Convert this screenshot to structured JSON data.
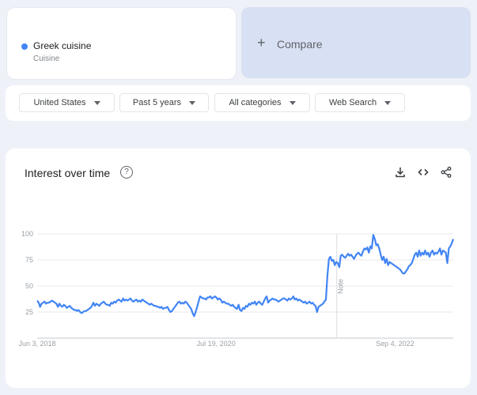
{
  "term": {
    "name": "Greek cuisine",
    "category": "Cuisine",
    "color": "#4285f4"
  },
  "compare": {
    "plus": "+",
    "label": "Compare"
  },
  "filters": [
    {
      "label": "United States"
    },
    {
      "label": "Past 5 years"
    },
    {
      "label": "All categories"
    },
    {
      "label": "Web Search"
    }
  ],
  "chart_card": {
    "title": "Interest over time",
    "help_icon": "?",
    "tools": [
      "download-icon",
      "embed-code-icon",
      "share-icon"
    ]
  },
  "chart_data": {
    "type": "line",
    "title": "Interest over time",
    "xlabel": "",
    "ylabel": "",
    "ylim": [
      0,
      100
    ],
    "yticks": [
      "25",
      "50",
      "75",
      "100"
    ],
    "ytick_values": [
      25,
      50,
      75,
      100
    ],
    "xticks": [
      "Jun 3, 2018",
      "Jul 19, 2020",
      "Sep 4, 2022"
    ],
    "grid": true,
    "annotation": {
      "label": "Note",
      "at_fraction": 0.72
    },
    "series": [
      {
        "name": "Greek cuisine",
        "color": "#4285f4",
        "values": [
          36,
          34,
          30,
          33,
          34,
          35,
          33,
          34,
          34,
          35,
          36,
          35,
          34,
          33,
          30,
          33,
          31,
          30,
          32,
          31,
          29,
          30,
          31,
          29,
          28,
          27,
          27,
          26,
          27,
          25,
          24,
          25,
          26,
          26,
          27,
          28,
          29,
          31,
          34,
          31,
          33,
          32,
          31,
          33,
          34,
          35,
          33,
          32,
          32,
          31,
          34,
          33,
          35,
          34,
          36,
          37,
          36,
          35,
          38,
          36,
          37,
          36,
          37,
          38,
          36,
          35,
          36,
          37,
          35,
          36,
          35,
          37,
          36,
          35,
          34,
          33,
          32,
          33,
          32,
          31,
          31,
          30,
          30,
          29,
          30,
          28,
          29,
          29,
          30,
          27,
          25,
          26,
          28,
          30,
          32,
          34,
          35,
          33,
          34,
          33,
          35,
          34,
          32,
          30,
          28,
          24,
          21,
          25,
          30,
          35,
          40,
          39,
          38,
          38,
          37,
          39,
          39,
          40,
          38,
          39,
          40,
          39,
          37,
          38,
          37,
          34,
          35,
          34,
          33,
          33,
          32,
          31,
          32,
          30,
          29,
          28,
          32,
          27,
          26,
          29,
          28,
          31,
          30,
          33,
          32,
          34,
          33,
          35,
          32,
          34,
          35,
          33,
          32,
          35,
          38,
          40,
          34,
          36,
          37,
          38,
          37,
          37,
          36,
          35,
          36,
          37,
          38,
          38,
          37,
          36,
          38,
          37,
          38,
          40,
          37,
          38,
          36,
          37,
          36,
          35,
          34,
          35,
          33,
          34,
          35,
          33,
          34,
          32,
          31,
          25,
          30,
          31,
          32,
          33,
          35,
          37,
          60,
          76,
          78,
          74,
          75,
          70,
          73,
          72,
          68,
          79,
          80,
          78,
          77,
          79,
          81,
          79,
          80,
          78,
          76,
          79,
          81,
          82,
          80,
          79,
          83,
          86,
          85,
          87,
          82,
          88,
          86,
          99,
          95,
          89,
          90,
          86,
          80,
          75,
          78,
          72,
          76,
          70,
          73,
          72,
          71,
          70,
          69,
          68,
          67,
          66,
          64,
          62,
          62,
          64,
          66,
          69,
          70,
          72,
          76,
          80,
          82,
          78,
          84,
          79,
          82,
          80,
          84,
          80,
          82,
          78,
          82,
          84,
          80,
          82,
          81,
          83,
          86,
          80,
          84,
          83,
          82,
          72,
          86,
          88,
          91,
          95
        ]
      }
    ]
  }
}
